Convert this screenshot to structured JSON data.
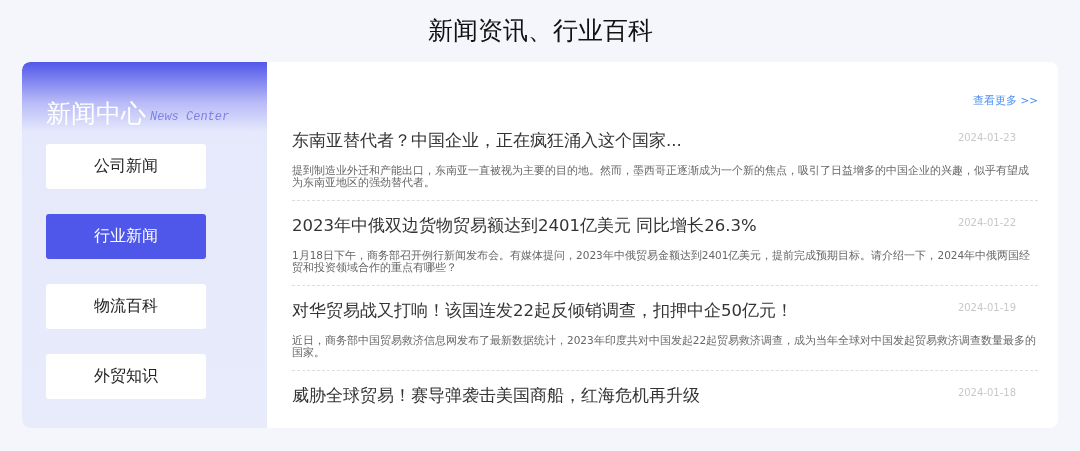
{
  "heading": "新闻资讯、行业百科",
  "sidebar": {
    "title": "新闻中心",
    "subtitle": "News Center",
    "items": [
      {
        "label": "公司新闻",
        "selected": false
      },
      {
        "label": "行业新闻",
        "selected": true
      },
      {
        "label": "物流百科",
        "selected": false
      },
      {
        "label": "外贸知识",
        "selected": false
      }
    ]
  },
  "more_link": "查看更多 >>",
  "news": [
    {
      "title": "东南亚替代者？中国企业，正在疯狂涌入这个国家...",
      "date": "2024-01-23",
      "summary": "提到制造业外迁和产能出口，东南亚一直被视为主要的目的地。然而，墨西哥正逐渐成为一个新的焦点，吸引了日益增多的中国企业的兴趣，似乎有望成为东南亚地区的强劲替代者。"
    },
    {
      "title": "2023年中俄双边货物贸易额达到2401亿美元 同比增长26.3%",
      "date": "2024-01-22",
      "summary": "1月18日下午，商务部召开例行新闻发布会。有媒体提问，2023年中俄贸易金额达到2401亿美元，提前完成预期目标。请介绍一下，2024年中俄两国经贸和投资领域合作的重点有哪些？"
    },
    {
      "title": "对华贸易战又打响！该国连发22起反倾销调查，扣押中企50亿元！",
      "date": "2024-01-19",
      "summary": "近日，商务部中国贸易救济信息网发布了最新数据统计，2023年印度共对中国发起22起贸易救济调查，成为当年全球对中国发起贸易救济调查数量最多的国家。"
    },
    {
      "title": "威胁全球贸易！赛导弹袭击美国商船，红海危机再升级",
      "date": "2024-01-18"
    }
  ]
}
